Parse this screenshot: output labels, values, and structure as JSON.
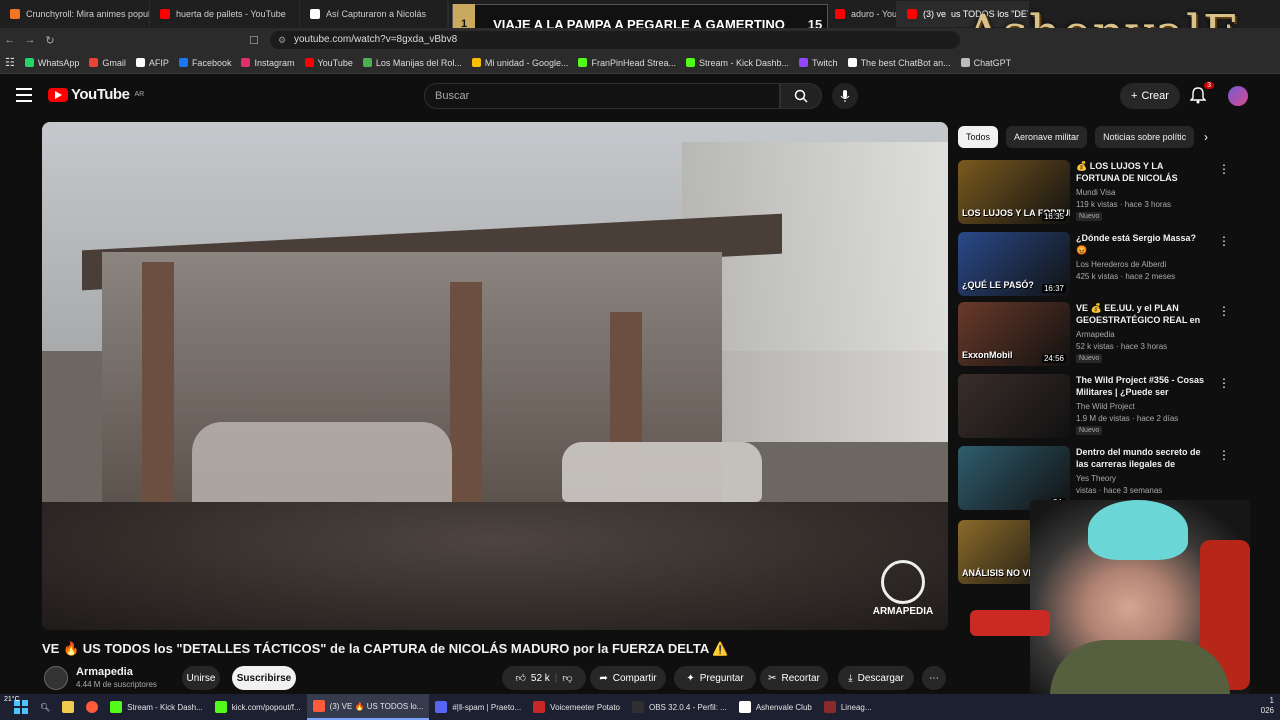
{
  "browser": {
    "tabs": [
      {
        "label": "Crunchyroll: Mira animes populares,",
        "color": "#f47521",
        "active": false
      },
      {
        "label": "huerta de pallets - YouTube",
        "color": "#ff0000",
        "active": false
      },
      {
        "label": "Así Capturaron a Nicolás",
        "color": "#ffffff",
        "active": false
      },
      {
        "label": "(3) ",
        "color": "#ff0000",
        "active": false
      },
      {
        "label": "aduro - YouTube",
        "color": "#ff0000",
        "active": false
      },
      {
        "label": "(3) ve ‍ us TODOS los \"DETA",
        "color": "#ff0000",
        "active": true
      }
    ],
    "url": "youtube.com/watch?v=8gxda_vBbv8",
    "bookmarks": [
      {
        "label": "WhatsApp",
        "color": "#25d366"
      },
      {
        "label": "Gmail",
        "color": "#ea4335"
      },
      {
        "label": "AFIP",
        "color": "#ffffff"
      },
      {
        "label": "Facebook",
        "color": "#1877f2"
      },
      {
        "label": "Instagram",
        "color": "#e1306c"
      },
      {
        "label": "YouTube",
        "color": "#ff0000"
      },
      {
        "label": "Los Manijas del Rol...",
        "color": "#4caf50"
      },
      {
        "label": "Mi unidad - Google...",
        "color": "#fbbc04"
      },
      {
        "label": "FranPinHead Strea...",
        "color": "#53fc18"
      },
      {
        "label": "Stream - Kick Dashb...",
        "color": "#53fc18"
      },
      {
        "label": "Twitch",
        "color": "#9146ff"
      },
      {
        "label": "The best ChatBot an...",
        "color": "#ffffff"
      },
      {
        "label": "ChatGPT",
        "color": "#bbbbbb"
      }
    ]
  },
  "overlay": {
    "banner_left_num": "1",
    "banner_text": "VIAJE A LA PAMPA A PEGARLE A GAMERTINO",
    "banner_right_num": "15",
    "logo": "AshenvalE"
  },
  "youtube": {
    "logo_text": "YouTube",
    "logo_region": "AR",
    "search_placeholder": "Buscar",
    "create_label": "Crear",
    "notif_count": "3"
  },
  "video": {
    "watermark": "ARMAPEDIA",
    "title": "VE 🔥 US TODOS los \"DETALLES TÁCTICOS\" de la CAPTURA de NICOLÁS MADURO por la FUERZA DELTA ⚠️",
    "channel_name": "Armapedia",
    "channel_subs": "4.44 M de suscriptores",
    "join_label": "Unirse",
    "subscribe_label": "Suscribirse",
    "likes": "52 k",
    "share_label": "Compartir",
    "ask_label": "Preguntar",
    "clip_label": "Recortar",
    "download_label": "Descargar"
  },
  "sidebar": {
    "chips": [
      "Todos",
      "Aeronave militar",
      "Noticias sobre polític"
    ],
    "recommendations": [
      {
        "title": "💰 LOS LUJOS Y LA FORTUNA DE NICOLÁS MADURO: el ...",
        "channel": "Mundi Visa",
        "meta": "119 k vistas · hace 3 horas",
        "duration": "16:35",
        "badge": "Nuevo",
        "thumb_text": "LOS LUJOS Y LA FORTUNA DE NICOLÁS MADURO",
        "thumb_color": "#7a5a1e"
      },
      {
        "title": "¿Dónde está Sergio Massa? 😡",
        "channel": "Los Herederos de Alberdi",
        "meta": "425 k vistas · hace 2 meses",
        "duration": "16:37",
        "badge": "",
        "thumb_text": "¿QUÉ LE PASÓ?",
        "thumb_color": "#2a4a8a"
      },
      {
        "title": "VE 💰 EE.UU. y el PLAN GEOESTRATÉGICO REAL en ...",
        "channel": "Armapedia",
        "meta": "52 k vistas · hace 3 horas",
        "duration": "24:56",
        "badge": "Nuevo",
        "thumb_text": "ExxonMobil",
        "thumb_color": "#6a3a2a"
      },
      {
        "title": "The Wild Project #356 - Cosas Militares | ¿Puede ser ejecutad...",
        "channel": "The Wild Project",
        "meta": "1.9 M de vistas · hace 2 días",
        "duration": "",
        "badge": "Nuevo",
        "thumb_text": "",
        "thumb_color": "#3a2e2a"
      },
      {
        "title": "Dentro del mundo secreto de las carreras ilegales de driftin...",
        "channel": "Yes Theory",
        "meta": "vistas · hace 3 semanas",
        "duration": "24:",
        "badge": "",
        "thumb_text": "",
        "thumb_color": "#2f5d6e"
      },
      {
        "title": "",
        "channel": "",
        "meta": "",
        "duration": "",
        "badge": "",
        "thumb_text": "ANÁLISIS NO VERBAL",
        "thumb_color": "#8a6a2a"
      }
    ]
  },
  "taskbar": {
    "temp": "21°C",
    "items": [
      {
        "label": "Stream - Kick Dash...",
        "color": "#53fc18",
        "active": false
      },
      {
        "label": "kick.com/popout/f...",
        "color": "#53fc18",
        "active": false
      },
      {
        "label": "(3) VE 🔥 US TODOS lo...",
        "color": "#ff5a3c",
        "active": true
      },
      {
        "label": "#|‖-spam | Praeto...",
        "color": "#5865f2",
        "active": false
      },
      {
        "label": "Voicemeeter Potato",
        "color": "#c62828",
        "active": false
      },
      {
        "label": "OBS 32.0.4 - Perfil: ...",
        "color": "#302e31",
        "active": false
      },
      {
        "label": "Ashenvale Club",
        "color": "#ffffff",
        "active": false
      },
      {
        "label": "Lineag...",
        "color": "#8b2a2a",
        "active": false
      }
    ],
    "clock_line1": "1",
    "clock_line2": "026"
  }
}
